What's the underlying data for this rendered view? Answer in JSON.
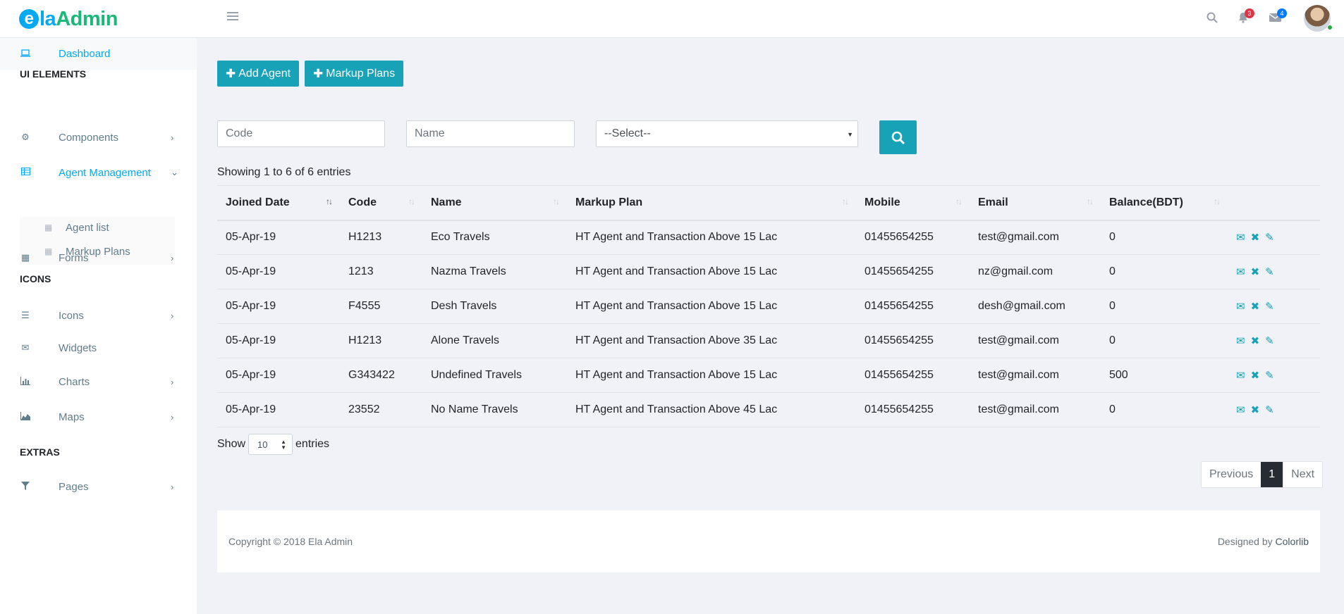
{
  "header": {
    "logo_e": "e",
    "logo_la": "la",
    "logo_admin": "Admin",
    "notifications_count": "3",
    "messages_count": "4"
  },
  "sidebar": {
    "dashboard": "Dashboard",
    "section_ui": "UI ELEMENTS",
    "components": "Components",
    "agent_management": "Agent Management",
    "agent_list": "Agent list",
    "markup_plans": "Markup Plans",
    "forms": "Forms",
    "section_icons": "ICONS",
    "icons": "Icons",
    "widgets": "Widgets",
    "charts": "Charts",
    "maps": "Maps",
    "section_extras": "EXTRAS",
    "pages": "Pages"
  },
  "toolbar": {
    "add_agent": "Add Agent",
    "markup_plans": "Markup Plans"
  },
  "filters": {
    "code_placeholder": "Code",
    "name_placeholder": "Name",
    "select_value": "--Select--"
  },
  "table": {
    "info": "Showing 1 to 6 of 6 entries",
    "headers": [
      "Joined Date",
      "Code",
      "Name",
      "Markup Plan",
      "Mobile",
      "Email",
      "Balance(BDT)"
    ],
    "rows": [
      [
        "05-Apr-19",
        "H1213",
        "Eco Travels",
        "HT Agent and Transaction Above 15 Lac",
        "01455654255",
        "test@gmail.com",
        "0"
      ],
      [
        "05-Apr-19",
        "1213",
        "Nazma Travels",
        "HT Agent and Transaction Above 15 Lac",
        "01455654255",
        "nz@gmail.com",
        "0"
      ],
      [
        "05-Apr-19",
        "F4555",
        "Desh Travels",
        "HT Agent and Transaction Above 15 Lac",
        "01455654255",
        "desh@gmail.com",
        "0"
      ],
      [
        "05-Apr-19",
        "H1213",
        "Alone Travels",
        "HT Agent and Transaction Above 35 Lac",
        "01455654255",
        "test@gmail.com",
        "0"
      ],
      [
        "05-Apr-19",
        "G343422",
        "Undefined Travels",
        "HT Agent and Transaction Above 15 Lac",
        "01455654255",
        "test@gmail.com",
        "500"
      ],
      [
        "05-Apr-19",
        "23552",
        "No Name Travels",
        "HT Agent and Transaction Above 45 Lac",
        "01455654255",
        "test@gmail.com",
        "0"
      ]
    ]
  },
  "length": {
    "show": "Show",
    "value": "10",
    "entries": "entries"
  },
  "pagination": {
    "previous": "Previous",
    "current": "1",
    "next": "Next"
  },
  "footer": {
    "copyright": "Copyright © 2018 Ela Admin",
    "designed_by": "Designed by",
    "designer": "Colorlib"
  },
  "colors": {
    "accent": "#17a2b8",
    "link": "#03a9f3",
    "brand_green": "#1bb87a"
  }
}
